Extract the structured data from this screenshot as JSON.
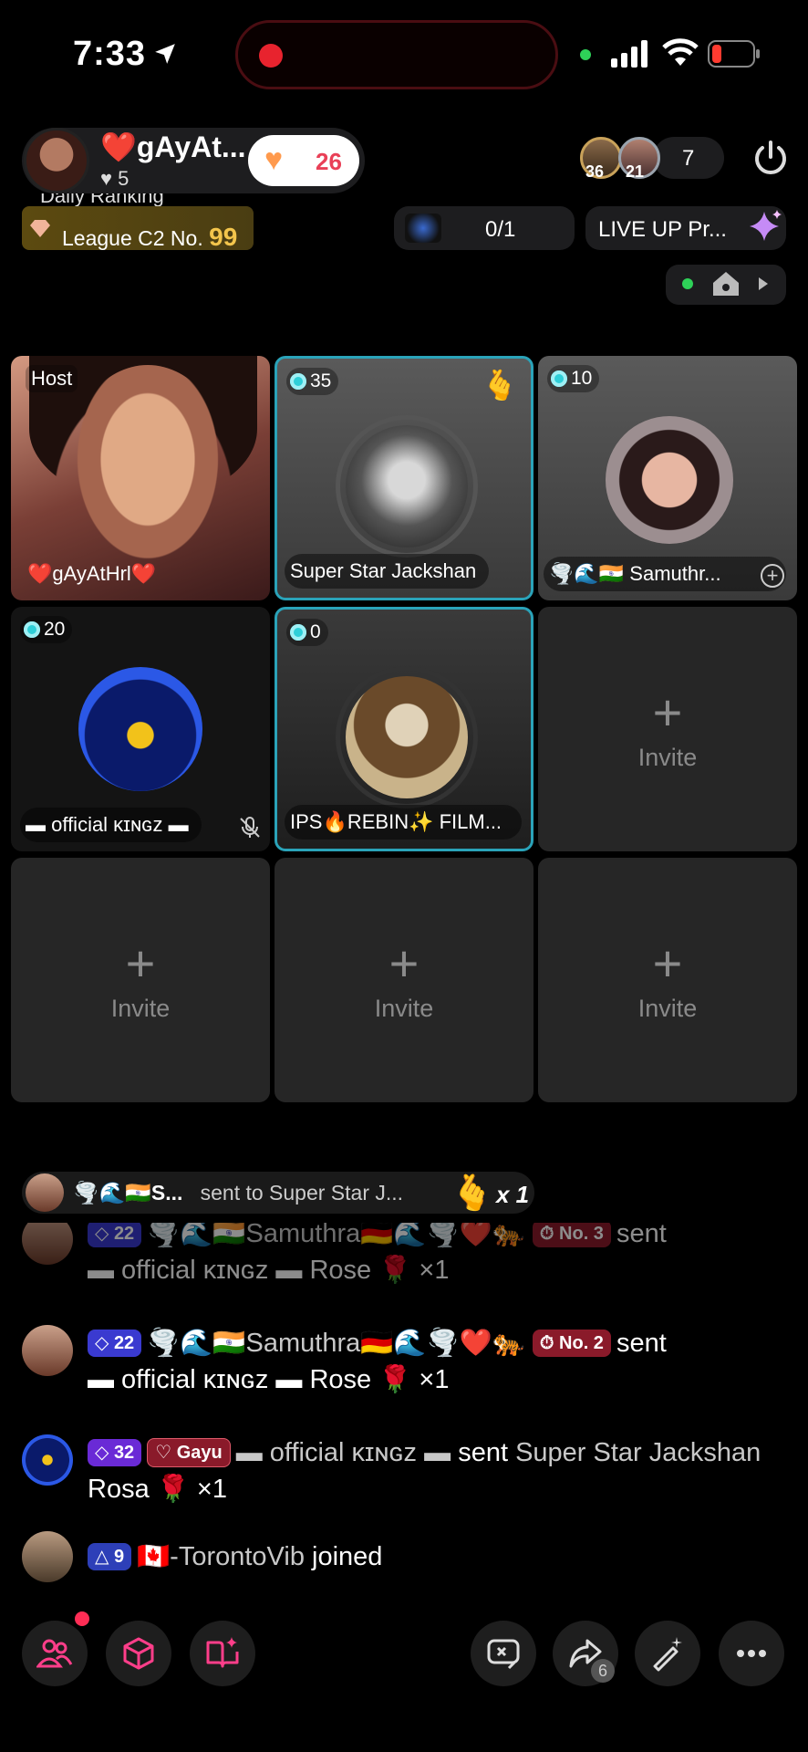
{
  "status_bar": {
    "time": "7:33"
  },
  "header": {
    "host_name": "❤️gAyAt...",
    "host_level": "♥ 5",
    "likes": "26",
    "viewer_badge_a": "36",
    "viewer_badge_b": "21",
    "viewer_count": "7",
    "ranking_label": "Daily Ranking",
    "league_label": "League C2 No.",
    "league_number": "99",
    "mission": "0/1",
    "liveup": "LIVE UP Pr..."
  },
  "grid": {
    "host": {
      "label": "Host",
      "name": "❤️gAyAtHrl❤️"
    },
    "slot2": {
      "score": "35",
      "name": "Super Star Jackshan"
    },
    "slot3": {
      "score": "10",
      "name": "🌪️🌊🇮🇳 Samuthr..."
    },
    "slot4": {
      "score": "20",
      "name": "▬ official ᴋɪɴɢᴢ ▬"
    },
    "slot5": {
      "score": "0",
      "name": "IPS🔥REBIN✨ FILM..."
    },
    "invite_plus": "+",
    "invite_label": "Invite"
  },
  "chat": {
    "gift_banner": {
      "sender": "🌪️🌊🇮🇳S...",
      "text": "sent to Super Star J...",
      "emoji": "🫰",
      "mult": "x 1"
    },
    "messages": [
      {
        "level": "22",
        "sender": "🌪️🌊🇮🇳Samuthra🇩🇪🌊🌪️❤️🐅",
        "rank": "No. 3",
        "verb": "sent",
        "target": "▬ official ᴋɪɴɢᴢ ▬",
        "gift": "Rose 🌹 ×1"
      },
      {
        "level": "22",
        "sender": "🌪️🌊🇮🇳Samuthra🇩🇪🌊🌪️❤️🐅",
        "rank": "No. 2",
        "verb": "sent",
        "target": "▬ official ᴋɪɴɢᴢ ▬",
        "gift": "Rose 🌹 ×1"
      },
      {
        "level": "32",
        "fan": "Gayu",
        "sender": "▬ official ᴋɪɴɢᴢ ▬",
        "verb": "sent",
        "target": "Super Star Jackshan",
        "gift": "Rosa 🌹 ×1"
      },
      {
        "level": "9",
        "sender": "🇨🇦-TorontoVib",
        "verb": "joined"
      }
    ]
  },
  "bottom_bar": {
    "share_count": "6"
  },
  "colors": {
    "accent_cyan": "#2aa3b9",
    "like_red": "#e94057",
    "league_gold": "#f3c54c"
  }
}
